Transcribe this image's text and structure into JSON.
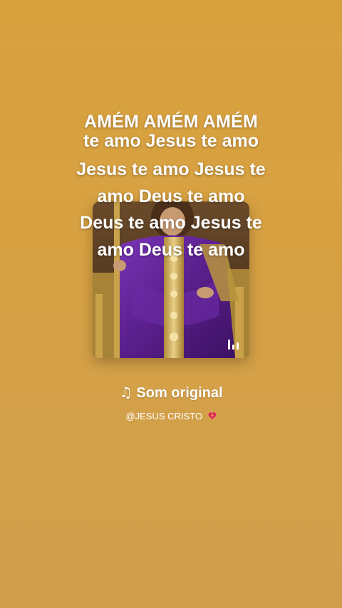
{
  "lyrics": {
    "title": "AMÉM AMÉM AMÉM",
    "lines": [
      "te amo Jesus te amo",
      "Jesus te amo Jesus te",
      "amo Deus te amo",
      "Deus te amo Jesus te",
      "amo Deus te amo"
    ]
  },
  "sound": {
    "note_icon": "♫",
    "title": "Som original",
    "author": "@JESUS CRISTO",
    "author_emoji": "heart-icon"
  },
  "colors": {
    "background_top": "#d9a13e",
    "background_bottom": "#d09e4b",
    "text": "#ffffff",
    "robe_purple": "#5a1f8c",
    "gold": "#c9a24a"
  }
}
